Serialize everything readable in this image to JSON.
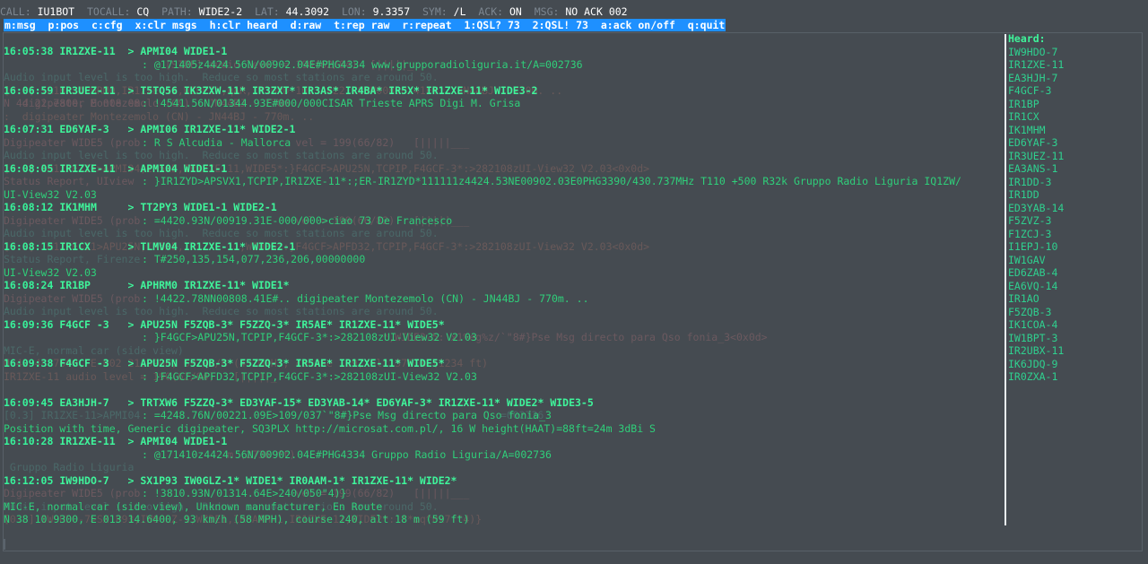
{
  "status": {
    "call_key": "CALL:",
    "call": "IU1BOT",
    "tocall_key": "TOCALL:",
    "tocall": "CQ",
    "path_key": "PATH:",
    "path": "WIDE2-2",
    "lat_key": "LAT:",
    "lat": "44.3092",
    "lon_key": "LON:",
    "lon": "9.3357",
    "sym_key": "SYM:",
    "sym": "/L",
    "ack_key": "ACK:",
    "ack": "ON",
    "msg_key": "MSG:",
    "msg": "NO ACK 002"
  },
  "menu": {
    "msg": "m:msg",
    "pos": "p:pos",
    "cfg": "c:cfg",
    "clr_msgs": "x:clr msgs",
    "clr_heard": "h:clr heard",
    "raw": "d:raw",
    "rep_raw": "t:rep raw",
    "repeat": "r:repeat",
    "qsl1": "1:QSL? 73",
    "qsl2": "2:QSL! 73",
    "ack_toggle": "a:ack on/off",
    "quit": "q:quit"
  },
  "packets": [
    {
      "time": "16:05:38",
      "from": "IR1ZXE-11",
      "path": "> APMI04 WIDE1-1",
      "payload": ": @171405z4424.56N/00902.04E#PHG4334 www.grupporadioliguria.it/A=002736",
      "ghost": [
        "                          [SIDE] audio level = 190(62/84)  [|||||_",
        "Audio input level is too high.  Reduce so most stations are around 50.",
        "[0.3] IR1BP>APHRM0,IR1ZXE-11,WIDE1*,qAR,IW1GPD-10:!4422.78NN00808.41E#.. JN44BJ - 770m. ..",
        "   digipeater Montezemolo (CN) - JN44BJ - 770m. .."
      ]
    },
    {
      "time": "16:06:59",
      "from": "IR3UEZ-11",
      "path": "> T5TQ56 IK3ZXW-11* IR3ZXT* IR3AS* IR4BA* IR5X* IR1ZXE-11* WIDE3-2",
      "payload": ": !4541.56N/01344.93E#000/000CISAR Trieste APRS Digi M. Grisa",
      "ghost": [
        "N 44 22.7800, E 008 08.",
        "",
        ":  digipeater Montezemolo (CN) - JN44BJ - 770m. .."
      ]
    },
    {
      "time": "16:07:31",
      "from": "ED6YAF-3",
      "path": "> APMI06 IR1ZXE-11* WIDE2-1",
      "payload": ": R S Alcudia - Mallorca",
      "ghost": [
        "Digipeater WIDE5 (prob                         vel = 199(66/82)   [|||||___",
        "Audio input level is too high.  Reduce so most stations are around 50.",
        "[0.3] IR1ZXE-11>APMI04,IR5AE,IR1ZXE-11,WIDE5*:}F4GCF>APU25N,TCPIP,F4GCF-3*:>282108zUI-View32 V2.03<0x0d>"
      ]
    },
    {
      "time": "16:08:05",
      "from": "IR1ZXE-11",
      "path": "> APMI04 WIDE1-1",
      "payload": ": }IR1ZYD>APSVX1,TCPIP,IR1ZXE-11*:;ER-IR1ZYD*111111z4424.53NE00902.03E0PHG3390/430.737MHz T110 +500 R32k Gruppo Radio Liguria IQ1ZW/",
      "cont": "UI-View32 V2.03",
      "ghost": [
        "Status Report, UIview"
      ]
    },
    {
      "time": "16:08:12",
      "from": "IK1MHM",
      "path": "> TT2PY3 WIDE1-1 WIDE2-1",
      "payload": ": =4420.93N/00919.31E-000/000>ciao 73 De Francesco",
      "ghost": [
        "Digipeater WIDE5 (prob                         vel = 199(66/82)   [|||||___",
        "Audio input level is too high.  Reduce so most stations are around 50.",
        "[0.3] IR1ZXE-11>APU25N,IR5AE,IR1ZXE-11,WIDE5*:}F4GCF>APFD32,TCPIP,F4GCF-3*:>282108zUI-View32 V2.03<0x0d>"
      ]
    },
    {
      "time": "16:08:15",
      "from": "IR1CX",
      "path": "> TLMV04 IR1ZXE-11* WIDE2-1",
      "payload": ": T#250,135,154,077,236,206,00000000",
      "cont": "UI-View32 V2.03",
      "ghost": [
        "",
        "Status Report, Firenze"
      ]
    },
    {
      "time": "16:08:24",
      "from": "IR1BP",
      "path": "> APHRM0 IR1ZXE-11* WIDE1*",
      "payload": ": !4422.78NN00808.41E#.. digipeater Montezemolo (CN) - JN44BJ - 770m. ..",
      "ghost": [
        "Digipeater WIDE5 (prob",
        "Audio input level is too high.  Reduce so most stations are around 50."
      ]
    },
    {
      "time": "16:09:36",
      "from": "F4GCF -3",
      "path": "> APU25N F5ZQB-3* F5ZZQ-3* IR5AE* IR1ZXE-11* WIDE5*",
      "payload": ": }F4GCF>APU25N,TCPIP,F4GCF-3*:>282108zUI-View32 V2.03",
      "ghost": [
        "                                                             *,WIDE3-5: x1%eg%z/`\"8#}Pse Msg directo para Qso fonia_3<0x0d>",
        "MIC-E, normal car (side view)",
        "N 42 48.7600, E 002 21.0900, 69 km/h (43 MPH), course 109, alt 376 m (1234 ft)"
      ]
    },
    {
      "time": "16:09:38",
      "from": "F4GCF -3",
      "path": "> APU25N F5ZQB-3* F5ZZQ-3* IR5AE* IR1ZXE-11* WIDE5*",
      "payload": ": }F4GCF>APFD32,TCPIP,F4GCF-3*:>282108zUI-View32 V2.03",
      "ghost": [
        "",
        "",
        "IR1ZXE-11 audio level = 190(62/84)   [|||||_"
      ]
    },
    {
      "time": "16:09:45",
      "from": "EA3HJH-7",
      "path": "> TRTXW6 F5ZZQ-3* ED3YAF-15* ED3YAB-14* ED6YAF-3* IR1ZXE-11* WIDE2* WIDE3-5",
      "payload": ": =4248.76N/00221.09E>109/037`\"8#}Pse Msg directo para Qso fonia_3",
      "cont": "Position with time, Generic digipeater, SQ3PLX http://microsat.com.pl/, 16 W height(HAAT)=88ft=24m 3dBi S",
      "ghost": [
        "",
        "[0.3] IR1ZXE-11>APMI04                                                          =002736"
      ]
    },
    {
      "time": "16:10:28",
      "R": "",
      "from": "IR1ZXE-11",
      "path": "> APMI04 WIDE1-1",
      "payload": ": @171410z4424.56N/00902.04E#PHG4334 Gruppo Radio Liguria/A=002736",
      "ghost": [
        "                                    m (2736 ft)",
        " Gruppo Radio Liguria"
      ]
    },
    {
      "time": "16:12:05",
      "from": "IW9HDO-7",
      "path": "> SX1P93 IW0GLZ-1* WIDE1* IR0AAM-1* IR1ZXE-11* WIDE2*",
      "payload": ": !3810.93N/01314.64E>240/050\"4)}",
      "cont": "MIC-E, normal car (side view), Unknown manufacturer, En Route",
      "cont2": "N 38 10.9300, E 013 14.6400, 93 km/h (58 MPH), course 240, alt 18 m (59 ft)",
      "ghost": [
        "Digipeater WIDE5 (prob                         vel = 199(66/82)   [|||||___",
        "Audio input level is too high.  Reduce so most stations are around 50.",
        "[0.3] IW9HDO-7>SX1P93,IW0GLZ-1,WIDE1,IR0AAM-1,IR1ZXE-11,WIDE2*:`!*uq^0x7f\"4)}"
      ]
    }
  ],
  "heard": {
    "title": "Heard:",
    "items": [
      "IW9HDO-7",
      "IR1ZXE-11",
      "EA3HJH-7",
      "F4GCF-3",
      "IR1BP",
      "IR1CX",
      "IK1MHM",
      "ED6YAF-3",
      "IR3UEZ-11",
      "EA3ANS-1",
      "IR1DD-3",
      "IR1DD",
      "ED3YAB-14",
      "F5ZVZ-3",
      "F1ZCJ-3",
      "I1EPJ-10",
      "IW1GAV",
      "ED6ZAB-4",
      "EA6VQ-14",
      "IR1AO",
      "F5ZQB-3",
      "IK1COA-4",
      "IW1BPT-3",
      "IR2UBX-11",
      "IK6JDQ-9",
      "IR0ZXA-1"
    ]
  }
}
